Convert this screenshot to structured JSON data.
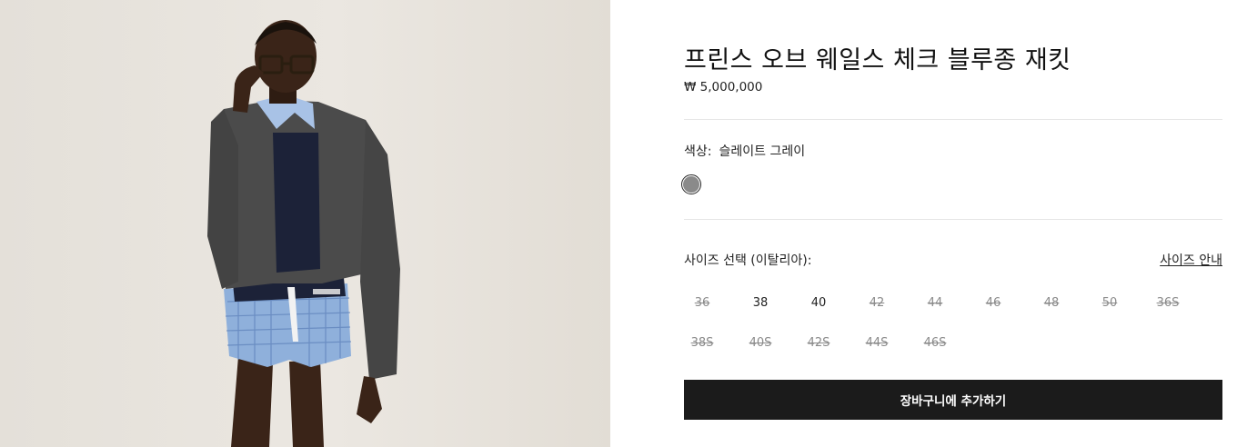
{
  "product": {
    "title": "프린스 오브 웨일스 체크 블루종 재킷",
    "price": "₩ 5,000,000"
  },
  "color": {
    "label": "색상:",
    "value": "슬레이트 그레이",
    "swatch_hex": "#8a8a8a"
  },
  "size": {
    "label": "사이즈 선택 (이탈리아):",
    "guide_link": "사이즈 안내",
    "options": [
      {
        "label": "36",
        "available": false
      },
      {
        "label": "38",
        "available": true
      },
      {
        "label": "40",
        "available": true
      },
      {
        "label": "42",
        "available": false
      },
      {
        "label": "44",
        "available": false
      },
      {
        "label": "46",
        "available": false
      },
      {
        "label": "48",
        "available": false
      },
      {
        "label": "50",
        "available": false
      },
      {
        "label": "36S",
        "available": false
      },
      {
        "label": "38S",
        "available": false
      },
      {
        "label": "40S",
        "available": false
      },
      {
        "label": "42S",
        "available": false
      },
      {
        "label": "44S",
        "available": false
      },
      {
        "label": "46S",
        "available": false
      }
    ]
  },
  "cart": {
    "button_label": "장바구니에 추가하기"
  },
  "colors": {
    "button_bg": "#1b1b1b",
    "soldout_text": "#8a8a8a",
    "image_bg": "#e8e4de"
  }
}
